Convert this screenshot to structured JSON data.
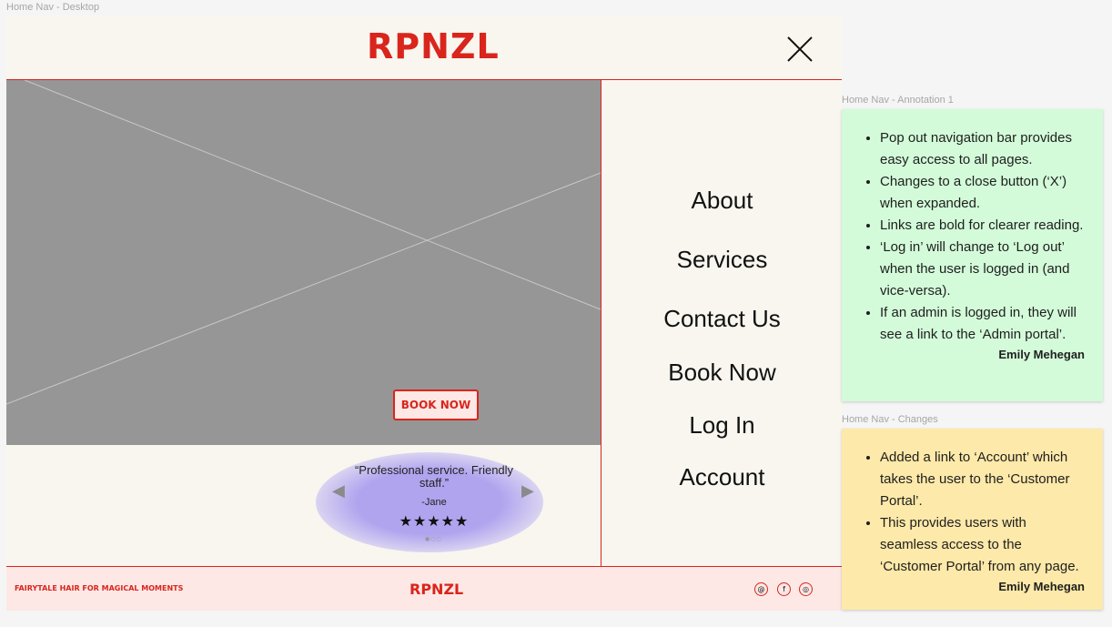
{
  "frames": {
    "desktop_label": "Home Nav - Desktop",
    "annotation_label": "Home Nav - Annotation 1",
    "changes_label": "Home Nav - Changes"
  },
  "header": {
    "logo": "RPNZL",
    "close_icon": "close-icon"
  },
  "hero": {
    "book_button": "BOOK NOW"
  },
  "review": {
    "quote": "“Professional service. Friendly staff.”",
    "author": "-Jane",
    "stars": "★★★★★",
    "rating": 5,
    "dots": "●○○"
  },
  "menu": {
    "items": [
      "About",
      "Services",
      "Contact Us",
      "Book Now",
      "Log In",
      "Account"
    ]
  },
  "footer": {
    "tagline": "FAIRYTALE HAIR FOR MAGICAL MOMENTS",
    "logo": "RPNZL",
    "social_icons": [
      "threads-icon",
      "facebook-icon",
      "instagram-icon"
    ]
  },
  "annotation": {
    "bullets": [
      "Pop out navigation bar provides easy access to all pages.",
      "Changes to a close button (‘X’) when expanded.",
      "Links are bold for clearer reading.",
      "‘Log in’ will change to ‘Log out’ when the user is logged in (and vice-versa).",
      "If an admin is logged in, they will see a link to the ‘Admin portal’."
    ],
    "signature": "Emily Mehegan",
    "color": "#d3fbd9"
  },
  "changes": {
    "bullets": [
      "Added a link to ‘Account’ which takes the user to the ‘Customer Portal’.",
      "This provides users with seamless access to the ‘Customer Portal’ from any page."
    ],
    "signature": "Emily Mehegan",
    "color": "#fde9a9"
  },
  "colors": {
    "brand_red": "#d9251c",
    "cream": "#f8f6ef",
    "placeholder_gray": "#969696"
  }
}
